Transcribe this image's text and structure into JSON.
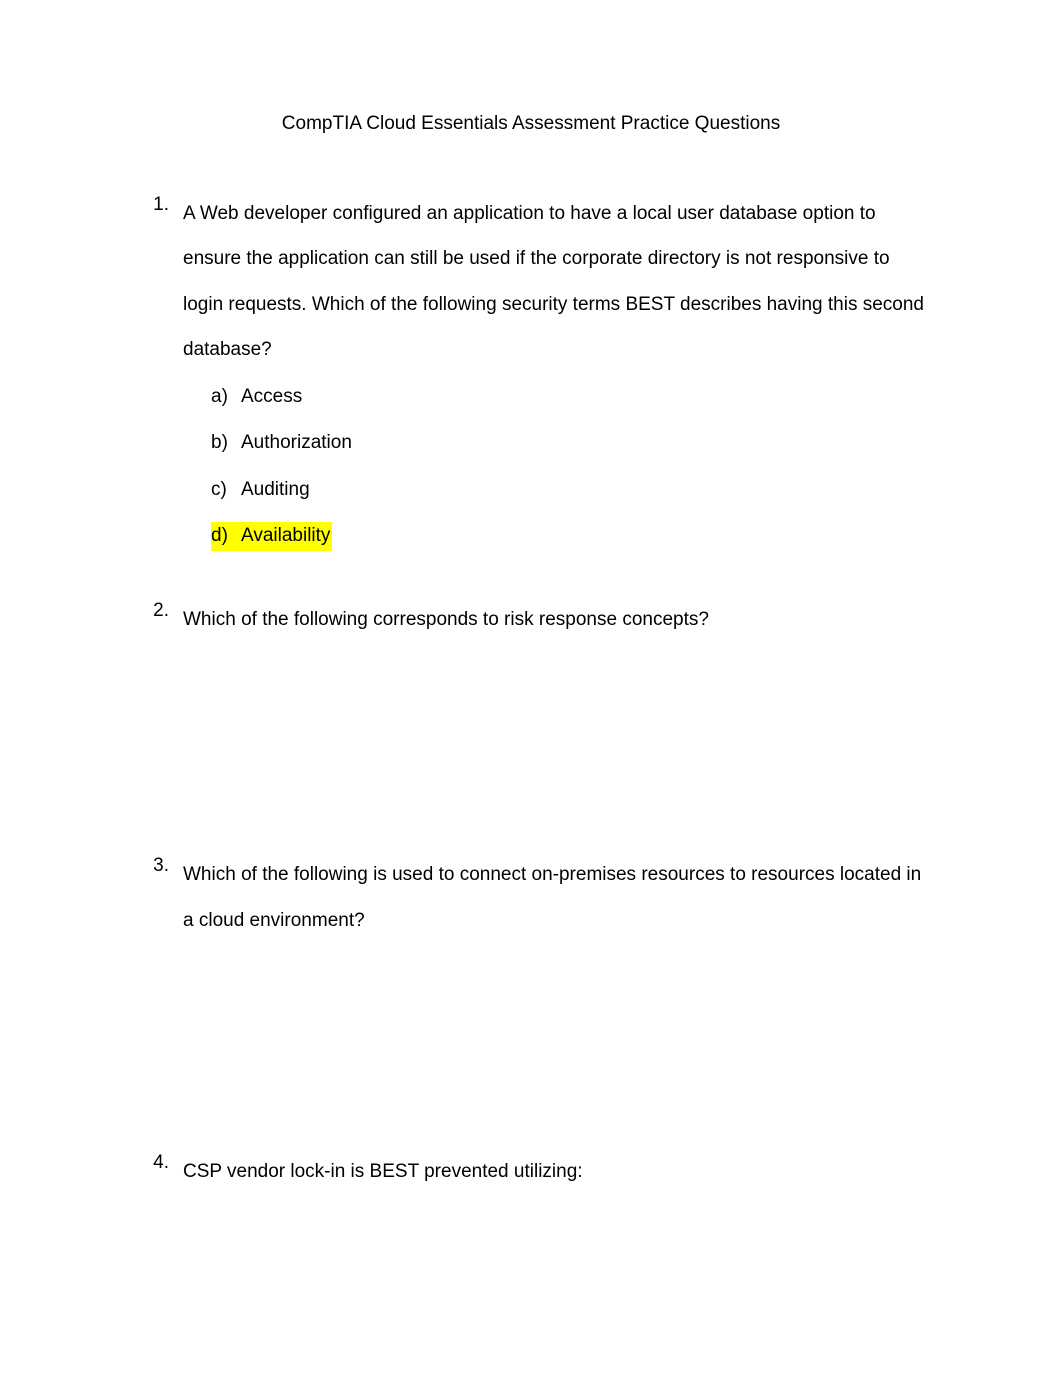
{
  "title": "CompTIA Cloud Essentials Assessment Practice Questions",
  "questions": [
    {
      "number": "1.",
      "text": "A Web developer configured an application to have a local user database option to ensure the application can still be used if the corporate directory is not responsive to login requests. Which of the following security terms BEST describes having this second database?",
      "options": [
        {
          "letter": "a)",
          "text": "Access",
          "highlighted": false
        },
        {
          "letter": "b)",
          "text": "Authorization",
          "highlighted": false
        },
        {
          "letter": "c)",
          "text": "Auditing",
          "highlighted": false
        },
        {
          "letter": "d)",
          "text": "Availability",
          "highlighted": true
        }
      ]
    },
    {
      "number": "2.",
      "text": "Which of the following corresponds to risk response concepts?",
      "options": []
    },
    {
      "number": "3.",
      "text": "Which of the following is used to connect on-premises resources to resources located in a cloud environment?",
      "options": []
    },
    {
      "number": "4.",
      "text": "CSP vendor lock-in is BEST prevented utilizing:",
      "options": []
    }
  ]
}
